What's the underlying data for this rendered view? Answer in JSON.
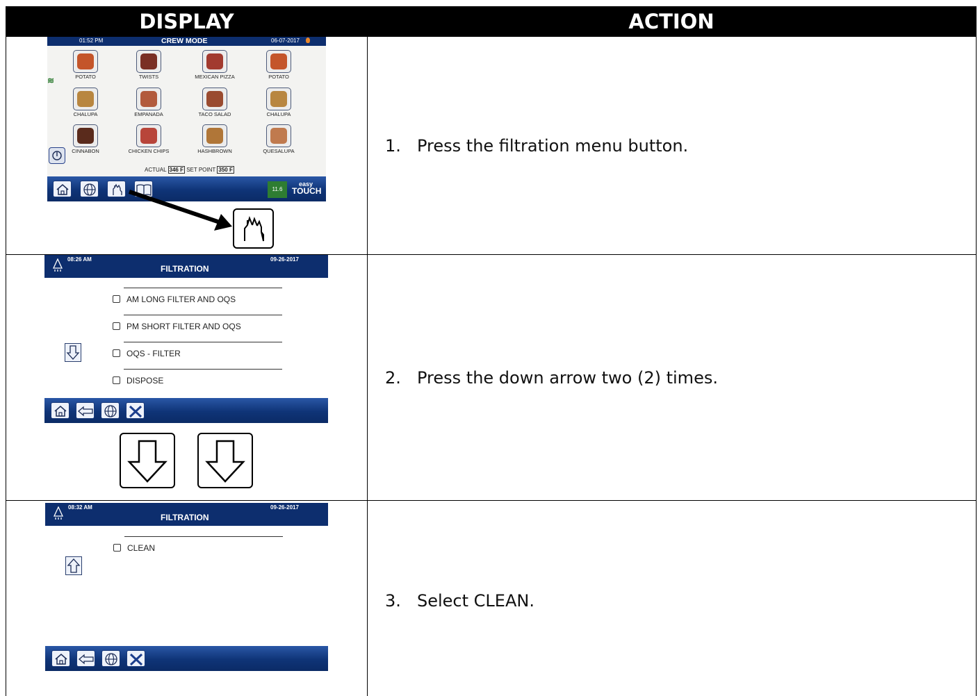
{
  "header": {
    "display": "DISPLAY",
    "action": "ACTION"
  },
  "rows": [
    {
      "number": "1.",
      "action": "Press the filtration menu button.",
      "screen": {
        "time": "01:52 PM",
        "title": "CREW MODE",
        "date": "06-07-2017",
        "items": [
          "POTATO",
          "TWISTS",
          "MEXICAN PIZZA",
          "POTATO",
          "CHALUPA",
          "EMPANADA",
          "TACO SALAD",
          "CHALUPA",
          "CINNABON",
          "CHICKEN CHIPS",
          "HASHBROWN",
          "QUESALUPA"
        ],
        "actual_label": "ACTUAL",
        "actual_value": "346 F",
        "setpoint_label": "SET POINT",
        "setpoint_value": "350 F",
        "level": "11.6",
        "brand_top": "easy",
        "brand_bottom": "TOUCH"
      },
      "callout_icon": "hand-filter-icon"
    },
    {
      "number": "2.",
      "action": "Press the down arrow two (2) times.",
      "screen": {
        "time": "08:26 AM",
        "title": "FILTRATION",
        "date": "09-26-2017",
        "options": [
          "AM LONG FILTER AND OQS",
          "PM SHORT FILTER AND OQS",
          "OQS - FILTER",
          "DISPOSE"
        ]
      },
      "callout_icon": "down-arrow-icon"
    },
    {
      "number": "3.",
      "action": "Select CLEAN.",
      "screen": {
        "time": "08:32 AM",
        "title": "FILTRATION",
        "date": "09-26-2017",
        "options": [
          "CLEAN"
        ]
      }
    }
  ],
  "colors": {
    "header_bg": "#000000",
    "screen_bar": "#0d2e6e",
    "level_badge": "#2e7d32"
  }
}
